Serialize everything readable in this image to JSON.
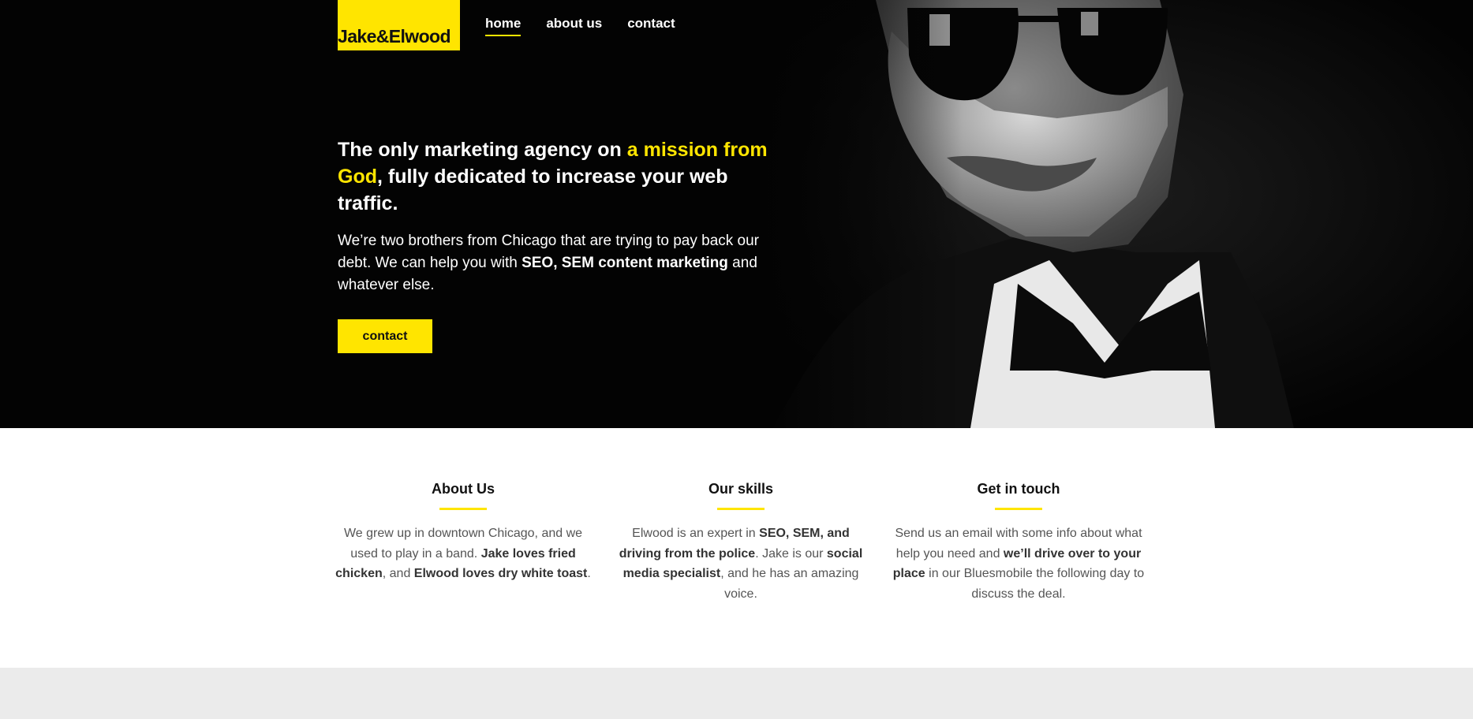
{
  "brand": {
    "logo_text": "Jake&Elwood",
    "accent_color": "#ffe500"
  },
  "nav": {
    "items": [
      {
        "label": "home",
        "active": true
      },
      {
        "label": "about us",
        "active": false
      },
      {
        "label": "contact",
        "active": false
      }
    ]
  },
  "hero": {
    "headline_a": "The only marketing agency on ",
    "headline_b": "a mission from God",
    "headline_c": ", fully dedicated to increase your web traffic.",
    "intro_a": "We’re two brothers from Chicago that are trying to pay back our debt. We can help you with ",
    "intro_b": "SEO, SEM content marketing",
    "intro_c": " and whatever else.",
    "cta_label": "contact",
    "image_icon": "man-with-sunglasses-photo"
  },
  "features": [
    {
      "title": "About Us",
      "t1": "We grew up in downtown Chicago, and we used to play in a band. ",
      "b1": "Jake loves fried chicken",
      "t2": ", and ",
      "b2": "Elwood loves dry white toast",
      "t3": "."
    },
    {
      "title": "Our skills",
      "t1": "Elwood is an expert in ",
      "b1": "SEO, SEM, and driving from the police",
      "t2": ". Jake is our ",
      "b2": "social media specialist",
      "t3": ", and he has an amazing voice."
    },
    {
      "title": "Get in touch",
      "t1": "Send us an email with some info about what help you need and ",
      "b1": "we’ll drive over to your place",
      "t2": " in our Bluesmobile the following day to discuss the deal.",
      "b2": "",
      "t3": ""
    }
  ]
}
